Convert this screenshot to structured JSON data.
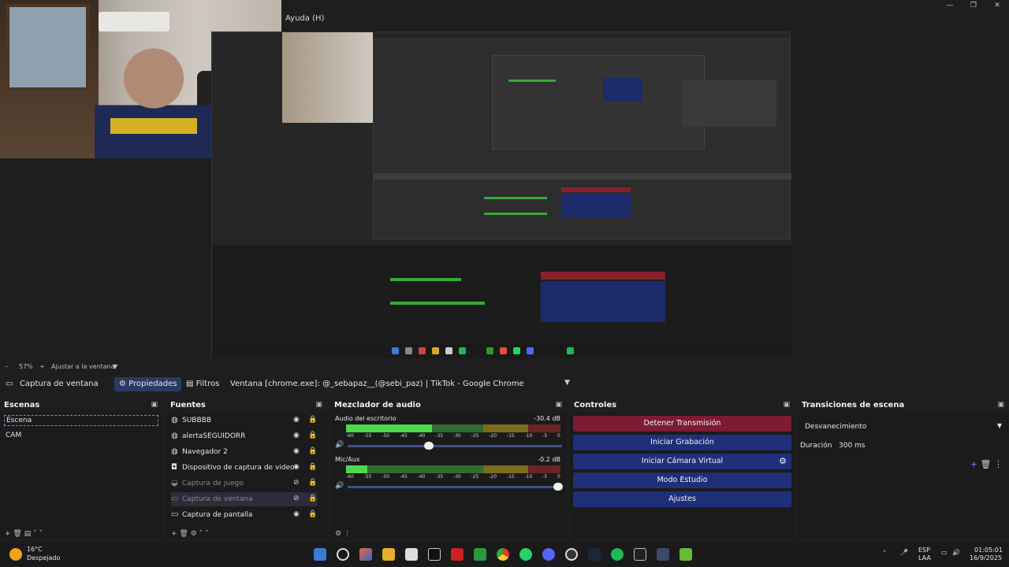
{
  "window": {
    "title": "Ayuda (H)",
    "controls": [
      "—",
      "❐",
      "✕"
    ]
  },
  "zoom": {
    "level": "57%",
    "plus": "+",
    "fit_label": "Ajustar a la ventana"
  },
  "source_toolbar": {
    "source_name": "Captura de ventana",
    "properties": "Propiedades",
    "filters": "Filtros",
    "window_label": "Ventana",
    "window_value": "[chrome.exe]: @_sebapaz__(@sebi_paz) | TikTok - Google Chrome"
  },
  "scenes": {
    "title": "Escenas",
    "items": [
      "Escena",
      "CAM"
    ]
  },
  "sources": {
    "title": "Fuentes",
    "items": [
      {
        "label": "SUBBBB",
        "icon": "globe-icon",
        "visible": true
      },
      {
        "label": "alertaSEGUIDORR",
        "icon": "globe-icon",
        "visible": true
      },
      {
        "label": "Navegador 2",
        "icon": "globe-icon",
        "visible": true
      },
      {
        "label": "Dispositivo de captura de video",
        "icon": "camera-icon",
        "visible": true
      },
      {
        "label": "Captura de juego",
        "icon": "gamepad-icon",
        "visible": false
      },
      {
        "label": "Captura de ventana",
        "icon": "window-icon",
        "visible": false
      },
      {
        "label": "Captura de pantalla",
        "icon": "monitor-icon",
        "visible": true
      }
    ]
  },
  "mixer": {
    "title": "Mezclador de audio",
    "ticks": [
      "-60",
      "-55",
      "-50",
      "-45",
      "-40",
      "-35",
      "-30",
      "-25",
      "-20",
      "-15",
      "-10",
      "-5",
      "0"
    ],
    "channels": [
      {
        "name": "Audio del escritorio",
        "db": "-30.4 dB",
        "level": 0.4,
        "volume": 0.38
      },
      {
        "name": "Mic/Aux",
        "db": "-0.2 dB",
        "level": 0.1,
        "volume": 0.98
      }
    ]
  },
  "controls": {
    "title": "Controles",
    "stop_stream": "Detener Transmisión",
    "start_record": "Iniciar Grabación",
    "virtual_cam": "Iniciar Cámara Virtual",
    "studio_mode": "Modo Estudio",
    "settings": "Ajustes"
  },
  "transitions": {
    "title": "Transiciones de escena",
    "selected": "Desvanecimiento",
    "duration_label": "Duración",
    "duration_value": "300 ms"
  },
  "taskbar": {
    "temperature": "16°C",
    "condition": "Despejado",
    "lang1": "ESP",
    "lang2": "LAA",
    "time": "01:05:01",
    "date": "16/9/2025"
  },
  "colors": {
    "accent_blue": "#1f2f7a",
    "stream_red": "#7e1a33",
    "bg": "#1e1e1e"
  }
}
